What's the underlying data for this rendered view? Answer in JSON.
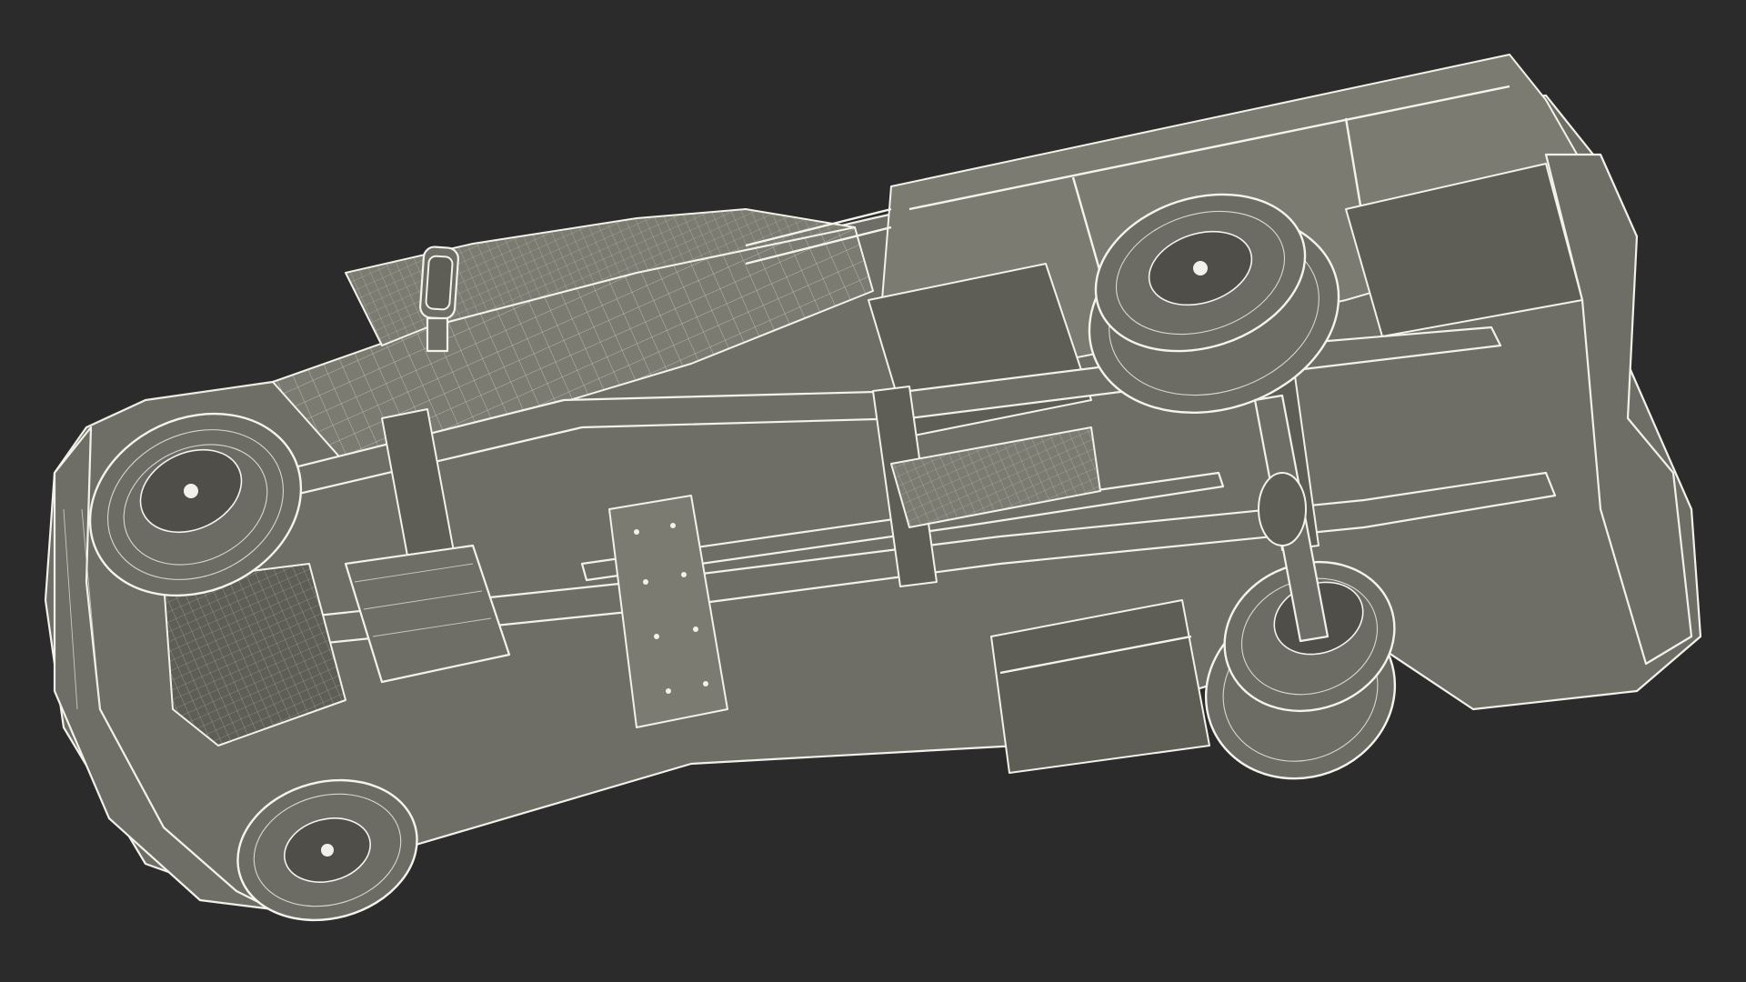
{
  "scene": {
    "background_color": "#2b2b2b",
    "model_fill_color": "#6f6e66",
    "wireframe_color": "#f2f1ea",
    "subject": "truck-underside-wireframe"
  }
}
